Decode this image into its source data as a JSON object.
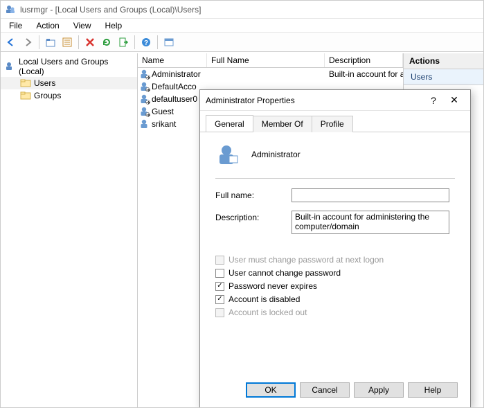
{
  "titlebar": {
    "text": "lusrmgr - [Local Users and Groups (Local)\\Users]"
  },
  "menubar": [
    "File",
    "Action",
    "View",
    "Help"
  ],
  "tree": {
    "root": "Local Users and Groups (Local)",
    "children": [
      {
        "label": "Users",
        "selected": true
      },
      {
        "label": "Groups",
        "selected": false
      }
    ]
  },
  "grid": {
    "headers": {
      "name": "Name",
      "full": "Full Name",
      "desc": "Description"
    },
    "rows": [
      {
        "name": "Administrator",
        "full": "",
        "desc": "Built-in account for ad",
        "icon": "user-disabled"
      },
      {
        "name": "DefaultAcco",
        "full": "",
        "desc": "",
        "icon": "user-disabled"
      },
      {
        "name": "defaultuser0",
        "full": "",
        "desc": "",
        "icon": "user-disabled"
      },
      {
        "name": "Guest",
        "full": "",
        "desc": "",
        "icon": "user-disabled"
      },
      {
        "name": "srikant",
        "full": "",
        "desc": "",
        "icon": "user"
      }
    ]
  },
  "actions": {
    "header": "Actions",
    "sub": "Users"
  },
  "dialog": {
    "title": "Administrator Properties",
    "tabs": [
      "General",
      "Member Of",
      "Profile"
    ],
    "active_tab": 0,
    "user_name": "Administrator",
    "labels": {
      "full_name": "Full name:",
      "description": "Description:"
    },
    "fields": {
      "full_name": "",
      "description": "Built-in account for administering the computer/domain"
    },
    "checks": [
      {
        "label": "User must change password at next logon",
        "checked": false,
        "disabled": true
      },
      {
        "label": "User cannot change password",
        "checked": false,
        "disabled": false
      },
      {
        "label": "Password never expires",
        "checked": true,
        "disabled": false
      },
      {
        "label": "Account is disabled",
        "checked": true,
        "disabled": false
      },
      {
        "label": "Account is locked out",
        "checked": false,
        "disabled": true
      }
    ],
    "buttons": {
      "ok": "OK",
      "cancel": "Cancel",
      "apply": "Apply",
      "help": "Help"
    }
  }
}
